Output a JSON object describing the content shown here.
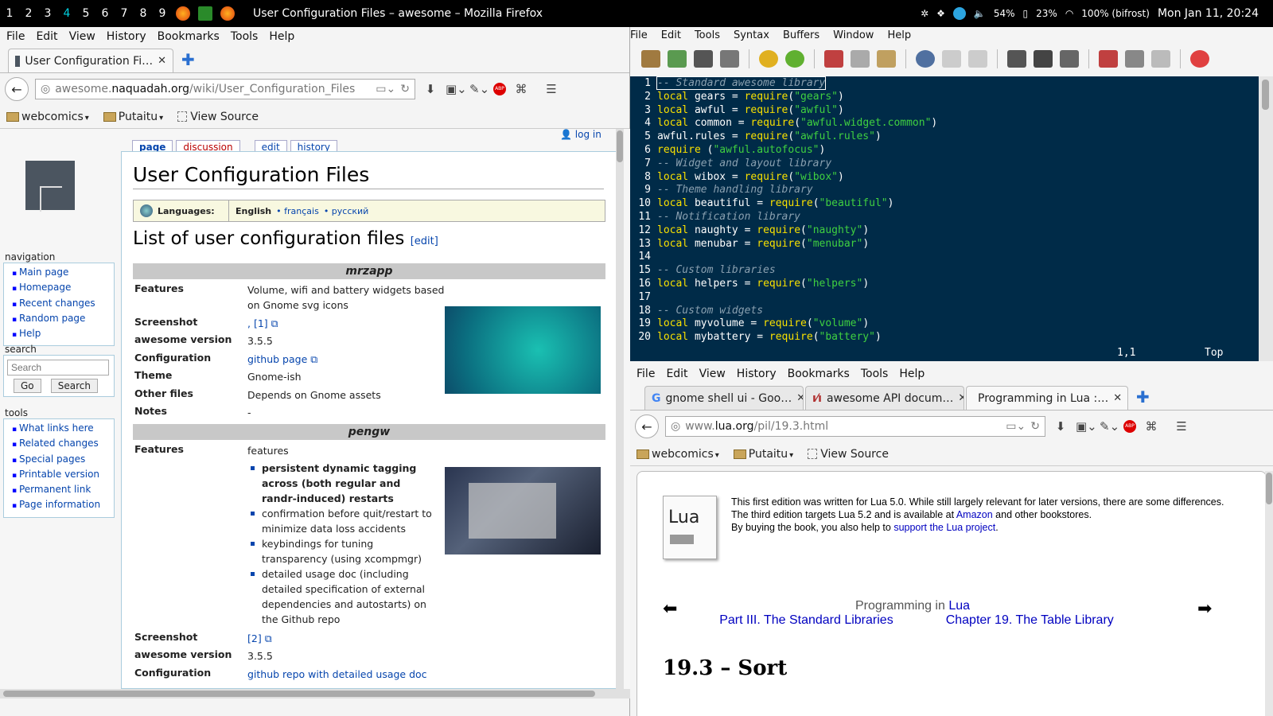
{
  "topbar": {
    "workspaces": [
      "1",
      "2",
      "3",
      "4",
      "5",
      "6",
      "7",
      "8",
      "9"
    ],
    "active_workspace": "4",
    "window_title": "User Configuration Files – awesome – Mozilla Firefox",
    "battery1": "54%",
    "battery2": "23%",
    "wifi": "100% (bifrost)",
    "clock": "Mon Jan 11, 20:24"
  },
  "ff_left": {
    "menu": [
      "File",
      "Edit",
      "View",
      "History",
      "Bookmarks",
      "Tools",
      "Help"
    ],
    "tab_title": "User Configuration Fi…",
    "url_prefix": "awesome.",
    "url_domain": "naquadah.org",
    "url_path": "/wiki/User_Configuration_Files",
    "bookmarks": [
      "webcomics",
      "Putaitu",
      "View Source"
    ]
  },
  "wiki": {
    "login": "log in",
    "page_tabs": [
      "page",
      "discussion",
      "edit",
      "history"
    ],
    "title": "User Configuration Files",
    "languages_label": "Languages:",
    "lang_current": "English",
    "lang_fr": "• français",
    "lang_ru": "• русский",
    "h2": "List of user configuration files",
    "h2_edit": "[edit]",
    "nav_header": "navigation",
    "nav_items": [
      "Main page",
      "Homepage",
      "Recent changes",
      "Random page",
      "Help"
    ],
    "search_header": "search",
    "search_placeholder": "Search",
    "go_label": "Go",
    "search_label": "Search",
    "tools_header": "tools",
    "tools_items": [
      "What links here",
      "Related changes",
      "Special pages",
      "Printable version",
      "Permanent link",
      "Page information"
    ],
    "entry1": {
      "name": "mrzapp",
      "features_k": "Features",
      "features_v": "Volume, wifi and battery widgets based on Gnome svg icons",
      "screenshot_k": "Screenshot",
      "screenshot_v": ", [1]",
      "version_k": "awesome version",
      "version_v": "3.5.5",
      "config_k": "Configuration",
      "config_v": "github page",
      "theme_k": "Theme",
      "theme_v": "Gnome-ish",
      "other_k": "Other files",
      "other_v": "Depends on Gnome assets",
      "notes_k": "Notes",
      "notes_v": "-"
    },
    "entry2": {
      "name": "pengw",
      "features_k": "Features",
      "features_v": "features",
      "feat_list": [
        "persistent dynamic tagging across (both regular and randr-induced) restarts",
        "confirmation before quit/restart to minimize data loss accidents",
        "keybindings for tuning transparency (using xcompmgr)",
        "detailed usage doc (including detailed specification of external dependencies and autostarts) on the Github repo"
      ],
      "screenshot_k": "Screenshot",
      "screenshot_v": "[2]",
      "version_k": "awesome version",
      "version_v": "3.5.5",
      "config_k": "Configuration",
      "config_v": "github repo with detailed usage doc"
    }
  },
  "gvim": {
    "menu": [
      "File",
      "Edit",
      "Tools",
      "Syntax",
      "Buffers",
      "Window",
      "Help"
    ],
    "lines": [
      {
        "n": "1",
        "parts": [
          [
            "cm",
            "-- Standard awesome library"
          ]
        ]
      },
      {
        "n": "2",
        "parts": [
          [
            "kw",
            "local"
          ],
          [
            "",
            "gears = "
          ],
          [
            "kw",
            "require"
          ],
          [
            "",
            "("
          ],
          [
            "st",
            "\"gears\""
          ],
          [
            "",
            ")"
          ]
        ]
      },
      {
        "n": "3",
        "parts": [
          [
            "kw",
            "local"
          ],
          [
            "",
            "awful = "
          ],
          [
            "kw",
            "require"
          ],
          [
            "",
            "("
          ],
          [
            "st",
            "\"awful\""
          ],
          [
            "",
            ")"
          ]
        ]
      },
      {
        "n": "4",
        "parts": [
          [
            "kw",
            "local"
          ],
          [
            "",
            "common = "
          ],
          [
            "kw",
            "require"
          ],
          [
            "",
            "("
          ],
          [
            "st",
            "\"awful.widget.common\""
          ],
          [
            "",
            ")"
          ]
        ]
      },
      {
        "n": "5",
        "parts": [
          [
            "",
            "awful.rules = "
          ],
          [
            "kw",
            "require"
          ],
          [
            "",
            "("
          ],
          [
            "st",
            "\"awful.rules\""
          ],
          [
            "",
            ")"
          ]
        ]
      },
      {
        "n": "6",
        "parts": [
          [
            "kw",
            "require"
          ],
          [
            "",
            "("
          ],
          [
            "st",
            "\"awful.autofocus\""
          ],
          [
            "",
            ")"
          ]
        ]
      },
      {
        "n": "7",
        "parts": [
          [
            "cm",
            "-- Widget and layout library"
          ]
        ]
      },
      {
        "n": "8",
        "parts": [
          [
            "kw",
            "local"
          ],
          [
            "",
            "wibox = "
          ],
          [
            "kw",
            "require"
          ],
          [
            "",
            "("
          ],
          [
            "st",
            "\"wibox\""
          ],
          [
            "",
            ")"
          ]
        ]
      },
      {
        "n": "9",
        "parts": [
          [
            "cm",
            "-- Theme handling library"
          ]
        ]
      },
      {
        "n": "10",
        "parts": [
          [
            "kw",
            "local"
          ],
          [
            "",
            "beautiful = "
          ],
          [
            "kw",
            "require"
          ],
          [
            "",
            "("
          ],
          [
            "st",
            "\"beautiful\""
          ],
          [
            "",
            ")"
          ]
        ]
      },
      {
        "n": "11",
        "parts": [
          [
            "cm",
            "-- Notification library"
          ]
        ]
      },
      {
        "n": "12",
        "parts": [
          [
            "kw",
            "local"
          ],
          [
            "",
            "naughty = "
          ],
          [
            "kw",
            "require"
          ],
          [
            "",
            "("
          ],
          [
            "st",
            "\"naughty\""
          ],
          [
            "",
            ")"
          ]
        ]
      },
      {
        "n": "13",
        "parts": [
          [
            "kw",
            "local"
          ],
          [
            "",
            "menubar = "
          ],
          [
            "kw",
            "require"
          ],
          [
            "",
            "("
          ],
          [
            "st",
            "\"menubar\""
          ],
          [
            "",
            ")"
          ]
        ]
      },
      {
        "n": "14",
        "parts": []
      },
      {
        "n": "15",
        "parts": [
          [
            "cm",
            "-- Custom libraries"
          ]
        ]
      },
      {
        "n": "16",
        "parts": [
          [
            "kw",
            "local"
          ],
          [
            "",
            "helpers = "
          ],
          [
            "kw",
            "require"
          ],
          [
            "",
            "("
          ],
          [
            "st",
            "\"helpers\""
          ],
          [
            "",
            ")"
          ]
        ]
      },
      {
        "n": "17",
        "parts": []
      },
      {
        "n": "18",
        "parts": [
          [
            "cm",
            "-- Custom widgets"
          ]
        ]
      },
      {
        "n": "19",
        "parts": [
          [
            "kw",
            "local"
          ],
          [
            "",
            "myvolume = "
          ],
          [
            "kw",
            "require"
          ],
          [
            "",
            "("
          ],
          [
            "st",
            "\"volume\""
          ],
          [
            "",
            ")"
          ]
        ]
      },
      {
        "n": "20",
        "parts": [
          [
            "kw",
            "local"
          ],
          [
            "",
            "mybattery = "
          ],
          [
            "kw",
            "require"
          ],
          [
            "",
            "("
          ],
          [
            "st",
            "\"battery\""
          ],
          [
            "",
            ")"
          ]
        ]
      }
    ],
    "cursor_pos": "1,1",
    "scroll_pos": "Top"
  },
  "ff_right": {
    "menu": [
      "File",
      "Edit",
      "View",
      "History",
      "Bookmarks",
      "Tools",
      "Help"
    ],
    "tabs": [
      "gnome shell ui - Goo…",
      "awesome API docum…",
      "Programming in Lua :…"
    ],
    "url_prefix": "www.",
    "url_domain": "lua.org",
    "url_path": "/pil/19.3.html",
    "bookmarks": [
      "webcomics",
      "Putaitu",
      "View Source"
    ],
    "book_label": "Lua",
    "intro1": "This first edition was written for Lua 5.0. While still largely relevant for later versions, there are some differences.",
    "intro2a": "The third edition targets Lua 5.2 and is available at ",
    "amazon": "Amazon",
    "intro2b": " and other bookstores.",
    "intro3a": "By buying the book, you also help to ",
    "support": "support the Lua project",
    "intro3b": ".",
    "nav_title": "Programming in ",
    "nav_title_lua": "Lua",
    "nav_part": "Part III. The Standard Libraries",
    "nav_chapter": "Chapter 19. The Table Library",
    "section": "19.3 – Sort"
  },
  "colors": {
    "accent_cyan": "#00d0e0",
    "vim_bg": "#002b48",
    "vim_keyword": "#f8e000",
    "vim_string": "#3fd040",
    "link": "#0645ad"
  }
}
